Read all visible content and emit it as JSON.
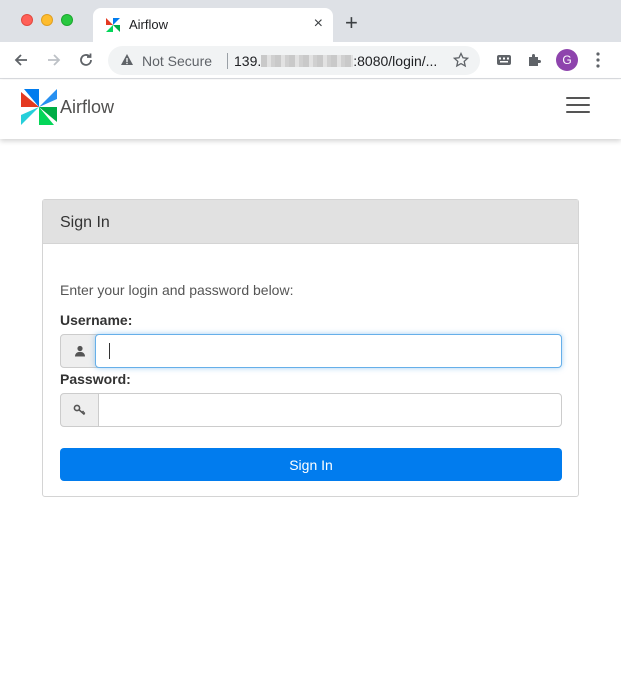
{
  "browser": {
    "tab_title": "Airflow",
    "tab_close": "×",
    "new_tab": "+",
    "security_label": "Not Secure",
    "url_prefix": "139.",
    "url_suffix": ":8080/login/...",
    "avatar_initial": "G"
  },
  "app": {
    "brand_name": "Airflow"
  },
  "login": {
    "title": "Sign In",
    "help_text": "Enter your login and password below:",
    "username_label": "Username:",
    "username_value": "",
    "password_label": "Password:",
    "password_value": "",
    "submit_label": "Sign In"
  },
  "colors": {
    "primary_button": "#017cee",
    "panel_header": "#e1e1e1",
    "focus_ring": "#66afe9"
  }
}
